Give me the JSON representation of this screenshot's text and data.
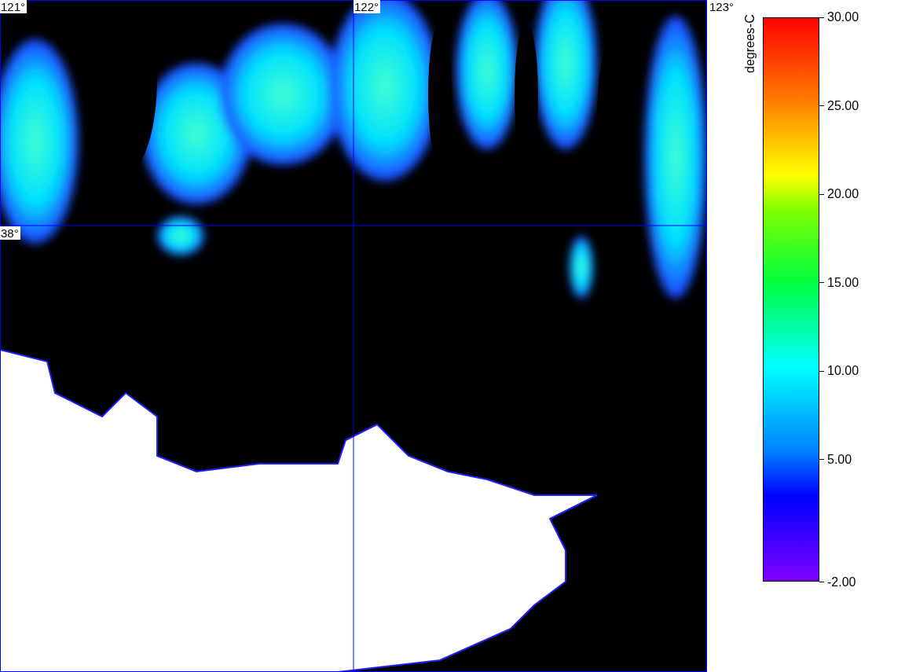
{
  "map": {
    "longitude_labels": [
      "121°",
      "122°",
      "123°"
    ],
    "latitude_labels": [
      "38°"
    ]
  },
  "colorbar": {
    "label": "degrees-C",
    "ticks": [
      "30.00",
      "25.00",
      "20.00",
      "15.00",
      "10.00",
      "5.00",
      "-2.00"
    ]
  }
}
